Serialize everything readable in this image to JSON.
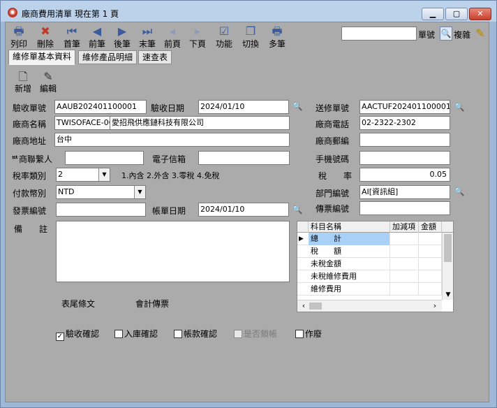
{
  "window": {
    "title": "廠商費用清單  現在第 1 頁",
    "min_label": "▁",
    "max_label": "▢",
    "close_label": "✕"
  },
  "toolbar": {
    "items": [
      {
        "label": "列印",
        "icon": "printer-icon",
        "glyph": "🖶"
      },
      {
        "label": "刪除",
        "icon": "delete-icon",
        "glyph": "✖"
      },
      {
        "label": "首筆",
        "icon": "first-record-icon",
        "glyph": "⏮"
      },
      {
        "label": "前筆",
        "icon": "previous-record-icon",
        "glyph": "◀"
      },
      {
        "label": "後筆",
        "icon": "next-record-icon",
        "glyph": "▶"
      },
      {
        "label": "末筆",
        "icon": "last-record-icon",
        "glyph": "⏭"
      },
      {
        "label": "前頁",
        "icon": "previous-page-icon",
        "glyph": "◂"
      },
      {
        "label": "下頁",
        "icon": "next-page-icon",
        "glyph": "▸"
      },
      {
        "label": "功能",
        "icon": "function-icon",
        "glyph": "☑"
      },
      {
        "label": "切換",
        "icon": "switch-icon",
        "glyph": "❐"
      },
      {
        "label": "多筆",
        "icon": "multi-record-icon",
        "glyph": "🖶"
      }
    ],
    "search_value": "",
    "search_type_label": "單號",
    "filter_label": "複雜"
  },
  "tabs": [
    {
      "label": "維修單基本資料",
      "active": true
    },
    {
      "label": "維修產品明細",
      "active": false
    },
    {
      "label": "速查表",
      "active": false
    }
  ],
  "subtoolbar": {
    "new_label": "新增",
    "edit_label": "編輯"
  },
  "form": {
    "acceptance_no_label": "驗收單號",
    "acceptance_no": "AAUB202401100001",
    "acceptance_date_label": "驗收日期",
    "acceptance_date": "2024/01/10",
    "delivery_no_label": "送修單號",
    "delivery_no": "AACTUF202401100001",
    "vendor_name_label": "廠商名稱",
    "vendor_code": "TWISOFACE-0C",
    "vendor_name": "愛招飛供應鏈科技有限公司",
    "vendor_phone_label": "廠商電話",
    "vendor_phone": "02-2322-2302",
    "vendor_address_label": "廠商地址",
    "vendor_address": "台中",
    "vendor_postal_label": "廠商郵編",
    "vendor_postal": "",
    "vendor_contact_label": "ᄨ商聯繫人",
    "vendor_contact": "",
    "email_label": "電子信箱",
    "email": "",
    "mobile_label": "手機號碼",
    "mobile": "",
    "tax_type_label": "稅率類別",
    "tax_type": "2",
    "tax_type_hint": "1.內含 2.外含 3.零稅 4.免稅",
    "tax_rate_label": "稅　　率",
    "tax_rate": "0.05",
    "currency_label": "付款幣別",
    "currency": "NTD",
    "department_label": "部門編號",
    "department": "AI[資訊組]",
    "invoice_no_label": "發票編號",
    "invoice_no": "",
    "bill_date_label": "帳單日期",
    "bill_date": "2024/01/10",
    "voucher_no_label": "傳票編號",
    "voucher_no": "",
    "remarks_label": "備　　註",
    "remarks": "",
    "footer_terms_label": "表尾條文",
    "accounting_voucher_label": "會計傳票"
  },
  "grid": {
    "columns": [
      "科目名稱",
      "加減項",
      "金額"
    ],
    "rows": [
      {
        "name": "總　　計",
        "adj": "",
        "amount": "",
        "selected": true
      },
      {
        "name": "稅　　額",
        "adj": "",
        "amount": "",
        "selected": false
      },
      {
        "name": "未稅金額",
        "adj": "",
        "amount": "",
        "selected": false
      },
      {
        "name": "未稅維修費用",
        "adj": "",
        "amount": "",
        "selected": false
      },
      {
        "name": "維修費用",
        "adj": "",
        "amount": "",
        "selected": false
      }
    ]
  },
  "checkboxes": [
    {
      "label": "驗收確認",
      "checked": true,
      "disabled": false
    },
    {
      "label": "入庫確認",
      "checked": false,
      "disabled": false
    },
    {
      "label": "帳款確認",
      "checked": false,
      "disabled": false
    },
    {
      "label": "是否鎖帳",
      "checked": false,
      "disabled": true
    },
    {
      "label": "作廢",
      "checked": false,
      "disabled": false
    }
  ]
}
